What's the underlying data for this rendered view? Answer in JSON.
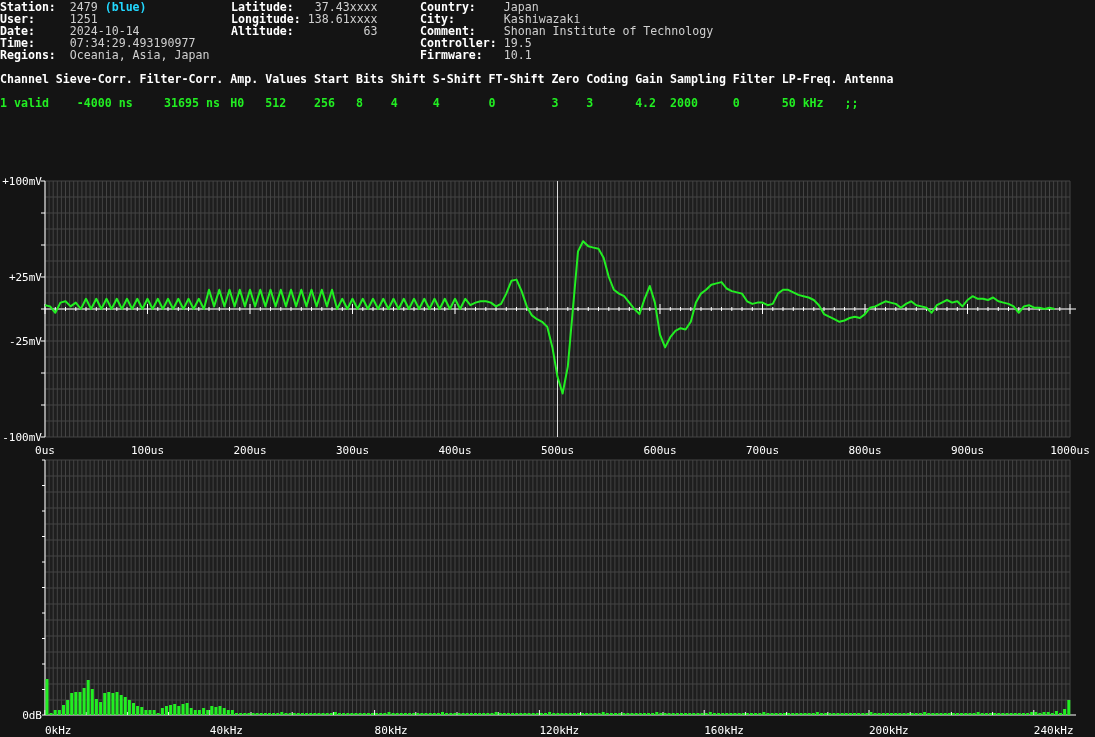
{
  "info_columns": [
    [
      {
        "label": "Station:",
        "value": "2479",
        "tag": "(blue)"
      },
      {
        "label": "User:",
        "value": "1251"
      },
      {
        "label": "Date:",
        "value": "2024-10-14"
      },
      {
        "label": "Time:",
        "value": "07:34:29.493190977"
      },
      {
        "label": "Regions:",
        "value": "Oceania, Asia, Japan"
      }
    ],
    [
      {
        "label": "Latitude:",
        "value": "37.43xxxx"
      },
      {
        "label": "Longitude:",
        "value": "138.61xxxx"
      },
      {
        "label": "Altitude:",
        "value": "63"
      }
    ],
    [
      {
        "label": "Country:",
        "value": "Japan"
      },
      {
        "label": "City:",
        "value": "Kashiwazaki"
      },
      {
        "label": "Comment:",
        "value": "Shonan Institute of Technology"
      },
      {
        "label": "Controller:",
        "value": "19.5"
      },
      {
        "label": "Firmware:",
        "value": "10.1"
      }
    ]
  ],
  "channels": {
    "columns": [
      "Channel",
      "Sieve-Corr.",
      "Filter-Corr.",
      "Amp.",
      "Values",
      "Start",
      "Bits",
      "Shift",
      "S-Shift",
      "FT-Shift",
      "Zero",
      "Coding",
      "Gain",
      "Sampling",
      "Filter",
      "LP-Freq.",
      "Antenna"
    ],
    "rows": [
      [
        "1 valid",
        "-4000 ns",
        "31695 ns",
        "H0",
        "512",
        "256",
        "8",
        "4",
        "4",
        "0",
        "3",
        "3",
        "4.2",
        "2000",
        "0",
        "50 kHz",
        ";;"
      ]
    ]
  },
  "waveform": {
    "chart_data": {
      "type": "line",
      "xlim": [
        0,
        1000
      ],
      "ylim": [
        -100,
        100
      ],
      "xticks": [
        {
          "value": 0,
          "label": "0us"
        },
        {
          "value": 100,
          "label": "100us"
        },
        {
          "value": 200,
          "label": "200us"
        },
        {
          "value": 300,
          "label": "300us"
        },
        {
          "value": 400,
          "label": "400us"
        },
        {
          "value": 500,
          "label": "500us"
        },
        {
          "value": 600,
          "label": "600us"
        },
        {
          "value": 700,
          "label": "700us"
        },
        {
          "value": 800,
          "label": "800us"
        },
        {
          "value": 900,
          "label": "900us"
        },
        {
          "value": 1000,
          "label": "1000us"
        }
      ],
      "yticks": [
        {
          "value": 100,
          "label": "+100mV"
        },
        {
          "value": 25,
          "label": "+25mV"
        },
        {
          "value": -25,
          "label": "-25mV"
        },
        {
          "value": -100,
          "label": "-100mV"
        }
      ],
      "ref_lines": [
        {
          "axis": "x",
          "value": 500
        }
      ],
      "grid": true,
      "x": [
        0,
        5,
        10,
        15,
        20,
        25,
        30,
        35,
        40,
        45,
        50,
        55,
        60,
        65,
        70,
        75,
        80,
        85,
        90,
        95,
        100,
        105,
        110,
        115,
        120,
        125,
        130,
        135,
        140,
        145,
        150,
        155,
        160,
        165,
        170,
        175,
        180,
        185,
        190,
        195,
        200,
        205,
        210,
        215,
        220,
        225,
        230,
        235,
        240,
        245,
        250,
        255,
        260,
        265,
        270,
        275,
        280,
        285,
        290,
        295,
        300,
        305,
        310,
        315,
        320,
        325,
        330,
        335,
        340,
        345,
        350,
        355,
        360,
        365,
        370,
        375,
        380,
        385,
        390,
        395,
        400,
        405,
        410,
        415,
        420,
        425,
        430,
        435,
        440,
        445,
        450,
        455,
        460,
        465,
        470,
        475,
        480,
        485,
        490,
        495,
        500,
        505,
        510,
        515,
        520,
        525,
        530,
        535,
        540,
        545,
        550,
        555,
        560,
        565,
        570,
        575,
        580,
        585,
        590,
        595,
        600,
        605,
        610,
        615,
        620,
        625,
        630,
        635,
        640,
        645,
        650,
        655,
        660,
        665,
        670,
        675,
        680,
        685,
        690,
        695,
        700,
        705,
        710,
        715,
        720,
        725,
        730,
        735,
        740,
        745,
        750,
        755,
        760,
        765,
        770,
        775,
        780,
        785,
        790,
        795,
        800,
        805,
        810,
        815,
        820,
        825,
        830,
        835,
        840,
        845,
        850,
        855,
        860,
        865,
        870,
        875,
        880,
        885,
        890,
        895,
        900,
        905,
        910,
        915,
        920,
        925,
        930,
        935,
        940,
        945,
        950,
        955,
        960,
        965,
        970,
        975,
        980,
        985
      ],
      "values": [
        3,
        2,
        -3,
        5,
        6,
        2,
        5,
        0,
        8,
        0,
        8,
        0,
        8,
        0,
        8,
        0,
        8,
        0,
        8,
        0,
        8,
        0,
        8,
        0,
        8,
        0,
        8,
        0,
        8,
        0,
        8,
        0,
        15,
        2,
        15,
        2,
        15,
        2,
        15,
        2,
        15,
        2,
        15,
        2,
        15,
        2,
        15,
        2,
        15,
        2,
        15,
        2,
        15,
        2,
        15,
        2,
        15,
        0,
        8,
        0,
        8,
        0,
        8,
        0,
        8,
        0,
        8,
        0,
        8,
        0,
        8,
        0,
        8,
        0,
        8,
        0,
        8,
        0,
        8,
        0,
        8,
        0,
        8,
        3,
        5,
        6,
        6,
        5,
        2,
        4,
        12,
        22,
        23,
        14,
        2,
        -5,
        -8,
        -10,
        -14,
        -30,
        -53,
        -66,
        -45,
        0,
        45,
        53,
        49,
        48,
        47,
        40,
        25,
        15,
        12,
        10,
        5,
        0,
        -4,
        8,
        18,
        5,
        -20,
        -30,
        -22,
        -17,
        -15,
        -16,
        -10,
        5,
        12,
        15,
        19,
        20,
        21,
        16,
        14,
        13,
        12,
        6,
        4,
        5,
        5,
        3,
        4,
        12,
        15,
        15,
        13,
        11,
        10,
        9,
        7,
        3,
        -4,
        -6,
        -8,
        -10,
        -9,
        -7,
        -6,
        -7,
        -4,
        1,
        2,
        4,
        6,
        5,
        4,
        1,
        4,
        6,
        3,
        2,
        1,
        -3,
        3,
        5,
        7,
        5,
        6,
        2,
        7,
        10,
        8,
        8,
        7,
        9,
        6,
        5,
        4,
        2,
        -3,
        2,
        3,
        1,
        1,
        0,
        1,
        0
      ]
    }
  },
  "spectrum": {
    "kind": "picture",
    "y_tick_label": "0dB",
    "x_tick_labels": [
      "0kHz",
      "40kHz",
      "80kHz",
      "120kHz",
      "160kHz",
      "200kHz",
      "240kHz"
    ]
  }
}
